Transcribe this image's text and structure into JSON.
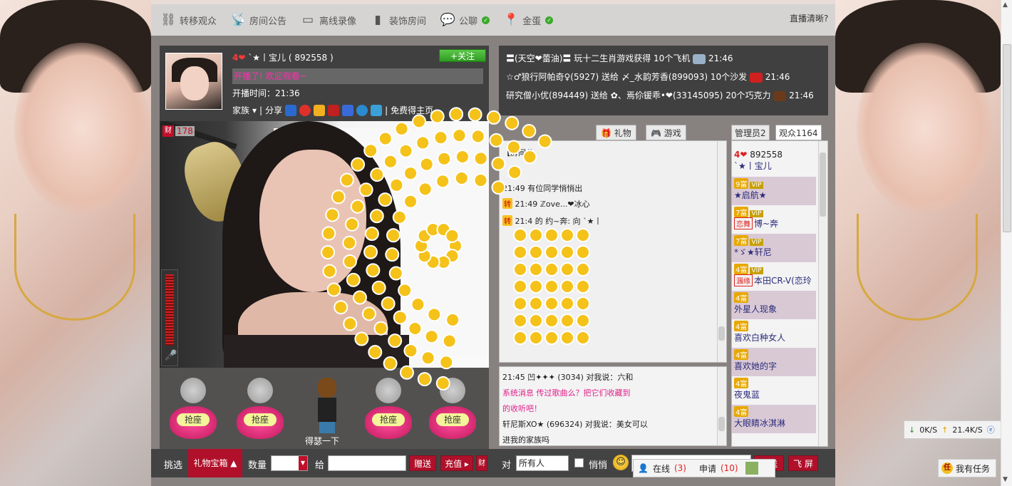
{
  "toolbar": {
    "items": [
      {
        "label": "转移观众",
        "icon": "link-icon"
      },
      {
        "label": "房间公告",
        "icon": "broadcast-tower-icon"
      },
      {
        "label": "离线录像",
        "icon": "video-icon"
      },
      {
        "label": "装饰房间",
        "icon": "decorate-icon"
      },
      {
        "label": "公聊",
        "icon": "chat-bubble-icon"
      },
      {
        "label": "金蛋",
        "icon": "location-pin-icon"
      }
    ],
    "quality_label": "直播清晰?"
  },
  "host": {
    "level": "4",
    "name": "`★丨宝儿",
    "id": "( 892558 )",
    "follow_label": "+关注",
    "welcome": "开播了! 欢迎观看~",
    "start_time": "开播时间：21:36",
    "family_label": "家族",
    "share_label": "分享",
    "free_label": "免费得主页"
  },
  "video": {
    "coin_label": "财",
    "coin_count": "178"
  },
  "seats": {
    "take_label": "抢座",
    "dancer_label": "得瑟一下"
  },
  "giftbar": {
    "pick_label": "挑选",
    "giftbox_label": "礼物宝箱",
    "qty_label": "数量",
    "to_label": "给",
    "give_label": "赠送",
    "recharge_label": "充值",
    "coin_label": "财"
  },
  "messages": [
    {
      "text": "〓(天空❤蕾油)〓 玩十二生肖游戏获得 10个飞机",
      "time": "21:46",
      "color": "#9ab0c8"
    },
    {
      "text": "☆♂狼行阿帕奇♀(5927) 送给 〆_水韵芳香(899093) 10个沙发",
      "time": "21:46",
      "color": "#d02020"
    },
    {
      "text": "研究僧小优(894449) 送给 ✿、焉伱锾乖•❤(33145095) 20个巧克力",
      "time": "21:46",
      "color": "#6a3a1a"
    }
  ],
  "chat_tabs": [
    {
      "label": "礼物"
    },
    {
      "label": "游戏"
    }
  ],
  "public_chat": [
    {
      "text": "【房间公"
    },
    {
      "text": "21:49 有位同学悄悄出"
    },
    {
      "badge": "转",
      "text": "21:49 ℤove...❤冰心"
    },
    {
      "badge": "转",
      "text": "21:4 的 约~奔: 向 `★丨"
    }
  ],
  "private_chat": [
    {
      "text": "21:45 凹✦✦✦ (3034) 对我说：六和",
      "pink": false
    },
    {
      "text": "系统消息 传过歌曲么？把它们收藏到",
      "pink": true
    },
    {
      "text": "的收听吧！",
      "pink": true
    },
    {
      "text": "轩尼斯XO★ (696324) 对我说：美女可以",
      "pink": false
    },
    {
      "text": "进我的家族吗",
      "pink": false
    }
  ],
  "user_tabs": {
    "admins": "管理员2",
    "audience": "观众1164"
  },
  "users": [
    {
      "rank": "4",
      "name": "892558",
      "sub": "`★丨宝儿",
      "vip": false,
      "tag": ""
    },
    {
      "rank": "9富",
      "name": "★启航★",
      "sub": "",
      "vip": true,
      "tag": ""
    },
    {
      "rank": "7富",
      "name": "博~奔",
      "sub": "",
      "vip": true,
      "tag": "恋舞"
    },
    {
      "rank": "7富",
      "name": "*ゞ★轩尼",
      "sub": "",
      "vip": true,
      "tag": ""
    },
    {
      "rank": "4富",
      "name": "本田CR-V(恋玲",
      "sub": "",
      "vip": true,
      "tag": "涠缘"
    },
    {
      "rank": "4富",
      "name": "外星人现象",
      "sub": "",
      "vip": false,
      "tag": ""
    },
    {
      "rank": "4富",
      "name": "喜欢白种女人",
      "sub": "",
      "vip": false,
      "tag": ""
    },
    {
      "rank": "4富",
      "name": "喜欢她的字",
      "sub": "",
      "vip": false,
      "tag": ""
    },
    {
      "rank": "4富",
      "name": "夜鬼蓝",
      "sub": "",
      "vip": false,
      "tag": ""
    },
    {
      "rank": "4富",
      "name": "大眼睛冰淇淋",
      "sub": "",
      "vip": false,
      "tag": ""
    }
  ],
  "bottombar": {
    "to_label": "对",
    "target_value": "所有人",
    "whisper_label": "悄悄",
    "send_label": "发送",
    "fly_label": "飞 屏"
  },
  "online": {
    "online_label": "在线",
    "online_count": "(3)",
    "apply_label": "申请",
    "apply_count": "(10)"
  },
  "net": {
    "down": "0K/S",
    "up": "21.4K/S"
  },
  "tasks": {
    "label": "我有任务"
  }
}
